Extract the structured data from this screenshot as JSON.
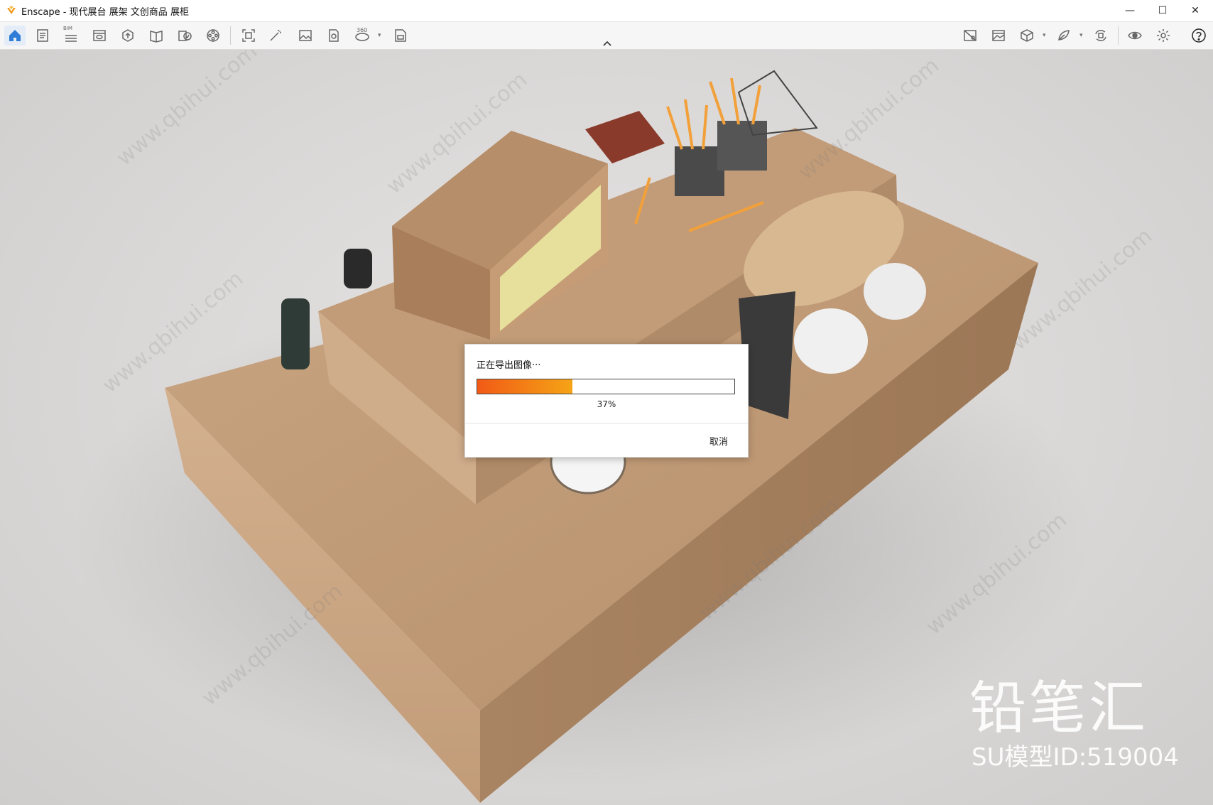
{
  "window": {
    "title": "Enscape - 现代展台 展架 文创商品 展柜",
    "controls": {
      "minimize": "—",
      "maximize": "☐",
      "close": "✕"
    }
  },
  "toolbar": {
    "left_icons": [
      "home-icon",
      "document-icon",
      "bim-icon",
      "view-icon",
      "upload-icon",
      "book-icon",
      "batch-export-icon",
      "video-icon",
      "screenshot-icon",
      "magic-wand-icon",
      "image-icon",
      "panorama-icon",
      "vr-360-icon",
      "exe-export-icon"
    ],
    "bim_label": "BIM",
    "vr_label": "360",
    "right_icons": [
      "atmosphere-icon",
      "landscape-icon",
      "cube-icon",
      "material-icon",
      "sync-icon",
      "visual-settings-icon",
      "settings-icon",
      "help-icon"
    ]
  },
  "dialog": {
    "title": "正在导出图像···",
    "progress_percent": 37,
    "progress_text": "37%",
    "cancel_label": "取消"
  },
  "watermark": {
    "brand": "铅笔汇",
    "model_id": "SU模型ID:519004",
    "url_text": "www.qbihui.com"
  },
  "colors": {
    "accent": "#f25a16",
    "accent_end": "#f5a416",
    "home_icon": "#2f7dd6",
    "wood": "#c7a07c"
  }
}
